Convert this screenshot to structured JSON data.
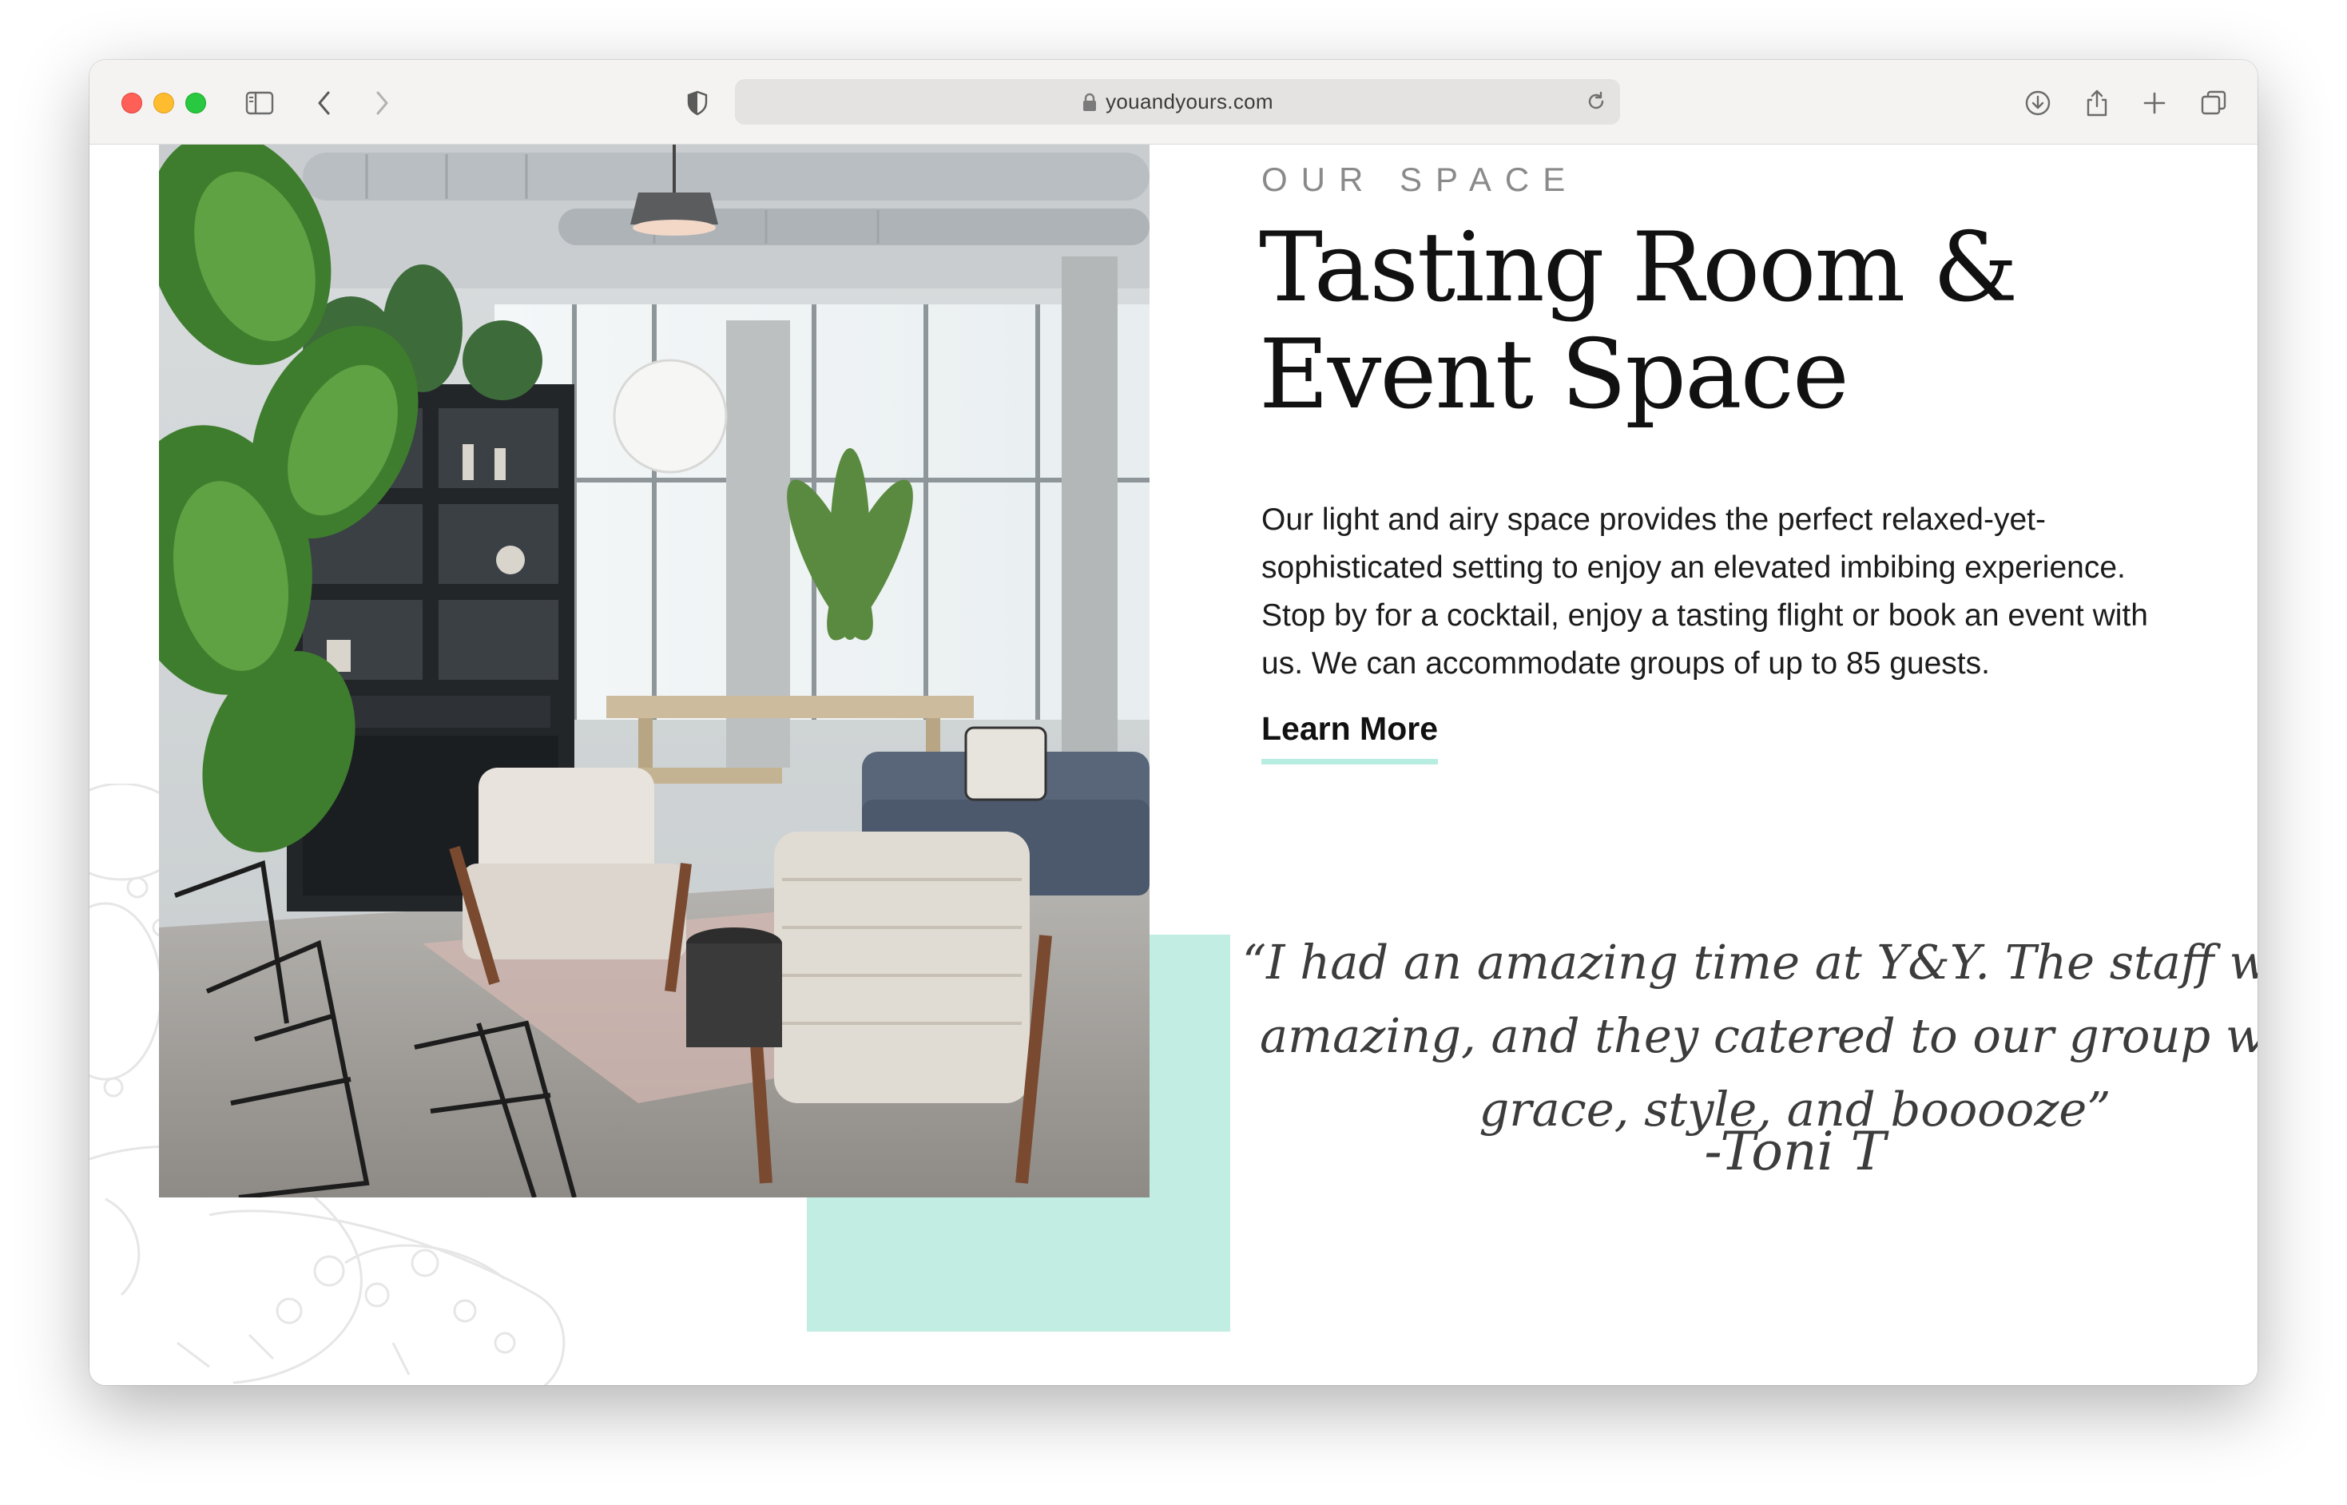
{
  "browser": {
    "url": "youandyours.com",
    "icons": {
      "sidebar": "sidebar-icon",
      "back": "chevron-left-icon",
      "forward": "chevron-right-icon",
      "shield": "shield-icon",
      "lock": "lock-icon",
      "reload": "reload-icon",
      "download": "download-icon",
      "share": "share-icon",
      "new_tab": "plus-icon",
      "tabs": "tabs-icon"
    }
  },
  "section": {
    "eyebrow": "OUR SPACE",
    "title_line1": "Tasting Room &",
    "title_line2": "Event Space",
    "body": "Our light and airy space provides the perfect relaxed-yet-sophisticated setting to enjoy an elevated imbibing experience. Stop by for a cocktail, enjoy a tasting flight or book an event with us. We can accommodate groups of up to 85 guests.",
    "cta_label": "Learn More"
  },
  "testimonial": {
    "quote": "“I had an amazing time at Y&Y. The staff were amazing, and they catered to our group with grace, style, and booooze”",
    "author": "-Toni T"
  },
  "colors": {
    "accent_mint": "#c1ede3",
    "underline_mint": "#b7ece0",
    "text": "#111111"
  }
}
